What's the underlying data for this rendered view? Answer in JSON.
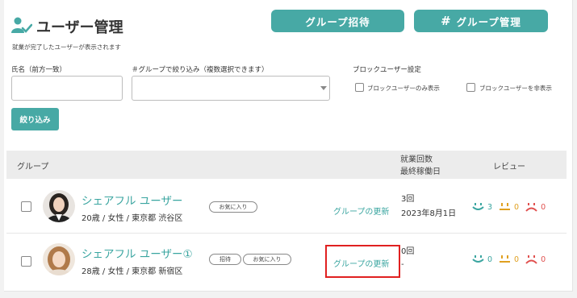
{
  "header": {
    "title": "ユーザー管理",
    "subtitle": "就業が完了したユーザーが表示されます",
    "invite_button": "グループ招待",
    "manage_button": "グループ管理",
    "manage_prefix": "#"
  },
  "filters": {
    "name_label": "氏名（前方一致）",
    "name_value": "",
    "group_label": "＃グループで絞り込み（複数選択できます）",
    "group_value": "",
    "block_label": "ブロックユーザー設定",
    "block_only_label": "ブロックユーザーのみ表示",
    "block_hide_label": "ブロックユーザーを非表示",
    "filter_button": "絞り込み"
  },
  "table": {
    "col_group": "グループ",
    "col_count_line1": "就業回数",
    "col_count_line2": "最終稼働日",
    "col_review": "レビュー",
    "rows": [
      {
        "name": "シェアフル ユーザー",
        "badge": "",
        "meta": "20歳 / 女性 / 東京都 渋谷区",
        "tags": [
          "お気に入り"
        ],
        "update_link": "グループの更新",
        "count": "3回",
        "last_date": "2023年8月1日",
        "review_good": "3",
        "review_normal": "0",
        "review_bad": "0"
      },
      {
        "name": "シェアフル ユーザー",
        "badge": "①",
        "meta": "28歳 / 女性 / 東京都 新宿区",
        "tags": [
          "招待",
          "お気に入り"
        ],
        "update_link": "グループの更新",
        "count": "0回",
        "last_date": "-",
        "review_good": "0",
        "review_normal": "0",
        "review_bad": "0"
      }
    ]
  },
  "colors": {
    "accent": "#47a9a5",
    "link": "#3aa5a0",
    "review_good": "#3aa5a0",
    "review_normal": "#e0a020",
    "review_bad": "#e0504e",
    "highlight_border": "#e02020"
  }
}
